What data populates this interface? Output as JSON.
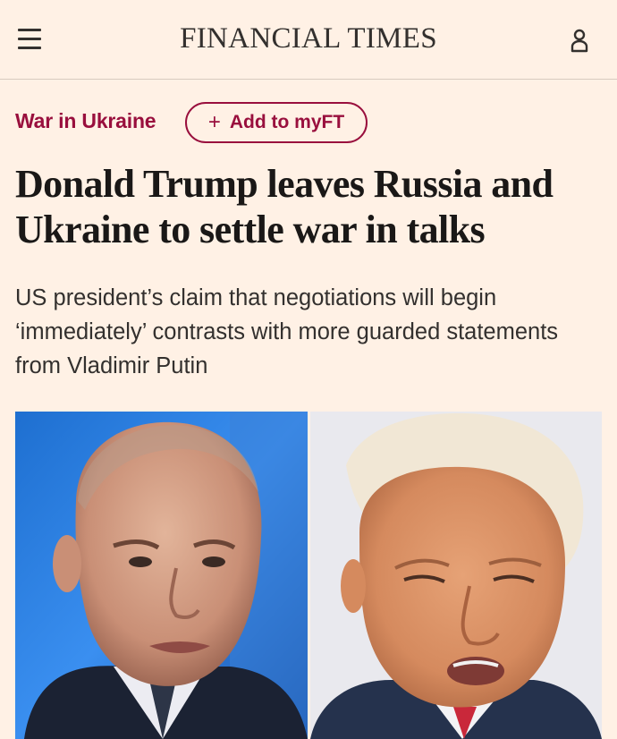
{
  "header": {
    "menu_icon": "hamburger-menu-icon",
    "masthead": "FINANCIAL TIMES",
    "account_icon": "user-account-icon"
  },
  "article": {
    "topic": "War in Ukraine",
    "follow_label": "Add to myFT",
    "follow_icon": "+",
    "headline": "Donald Trump leaves Russia and Ukraine to settle war in talks",
    "standfirst": "US president’s claim that negotiations will begin ‘immediately’ contrasts with more guarded statements from Vladimir Putin"
  },
  "colors": {
    "background": "#fff1e5",
    "accent": "#990f3d",
    "text": "#33302e"
  }
}
